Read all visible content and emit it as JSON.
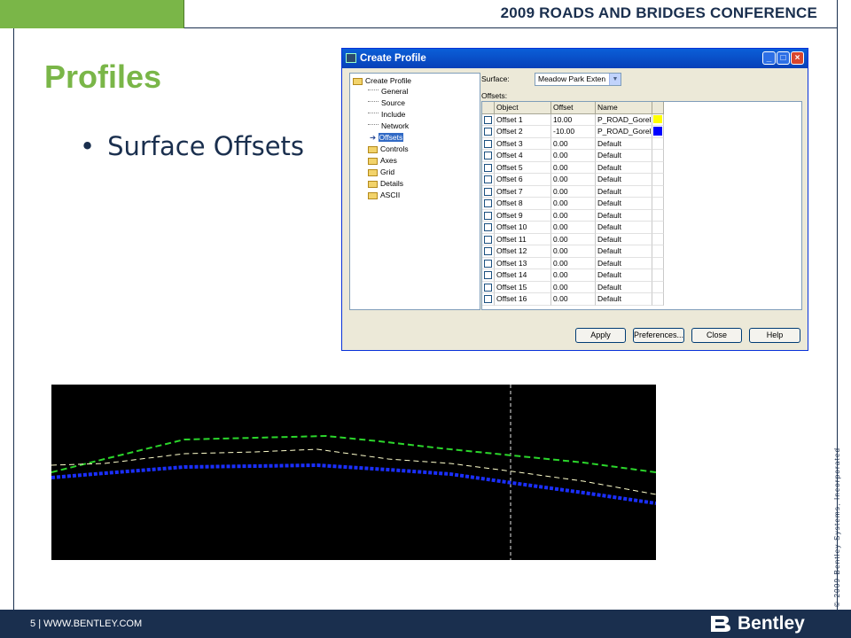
{
  "header": {
    "conference_title": "2009 ROADS AND BRIDGES CONFERENCE"
  },
  "slide": {
    "title": "Profiles",
    "bullets": [
      "Surface Offsets"
    ]
  },
  "side": {
    "copyright": "© 2009 Bentley Systems, Incorporated"
  },
  "footer": {
    "page_number": "5",
    "separator": "|",
    "url": "WWW.BENTLEY.COM",
    "logo_text": "Bentley"
  },
  "dialog": {
    "title": "Create Profile",
    "tree": {
      "root": "Create Profile",
      "items": [
        "General",
        "Source",
        "Include",
        "Network",
        "Offsets",
        "Controls",
        "Axes",
        "Grid",
        "Details",
        "ASCII"
      ],
      "selected": "Offsets"
    },
    "surface_label": "Surface:",
    "surface_value": "Meadow Park Exten",
    "offsets_label": "Offsets:",
    "columns": [
      "Object",
      "Offset",
      "Name"
    ],
    "rows": [
      {
        "object": "Offset 1",
        "offset": "10.00",
        "name": "P_ROAD_Gorel",
        "color": "#ffff00"
      },
      {
        "object": "Offset 2",
        "offset": "-10.00",
        "name": "P_ROAD_Gorel",
        "color": "#0000ff"
      },
      {
        "object": "Offset 3",
        "offset": "0.00",
        "name": "Default",
        "color": ""
      },
      {
        "object": "Offset 4",
        "offset": "0.00",
        "name": "Default",
        "color": ""
      },
      {
        "object": "Offset 5",
        "offset": "0.00",
        "name": "Default",
        "color": ""
      },
      {
        "object": "Offset 6",
        "offset": "0.00",
        "name": "Default",
        "color": ""
      },
      {
        "object": "Offset 7",
        "offset": "0.00",
        "name": "Default",
        "color": ""
      },
      {
        "object": "Offset 8",
        "offset": "0.00",
        "name": "Default",
        "color": ""
      },
      {
        "object": "Offset 9",
        "offset": "0.00",
        "name": "Default",
        "color": ""
      },
      {
        "object": "Offset 10",
        "offset": "0.00",
        "name": "Default",
        "color": ""
      },
      {
        "object": "Offset 11",
        "offset": "0.00",
        "name": "Default",
        "color": ""
      },
      {
        "object": "Offset 12",
        "offset": "0.00",
        "name": "Default",
        "color": ""
      },
      {
        "object": "Offset 13",
        "offset": "0.00",
        "name": "Default",
        "color": ""
      },
      {
        "object": "Offset 14",
        "offset": "0.00",
        "name": "Default",
        "color": ""
      },
      {
        "object": "Offset 15",
        "offset": "0.00",
        "name": "Default",
        "color": ""
      },
      {
        "object": "Offset 16",
        "offset": "0.00",
        "name": "Default",
        "color": ""
      }
    ],
    "buttons": {
      "apply": "Apply",
      "preferences": "Preferences...",
      "close": "Close",
      "help": "Help"
    }
  },
  "colors": {
    "brand_navy": "#1a2f4e",
    "brand_green": "#7ab648",
    "profile_green_line": "#2bd62b",
    "profile_white_line": "#ffffcc",
    "profile_blue_line": "#1a2fff"
  }
}
